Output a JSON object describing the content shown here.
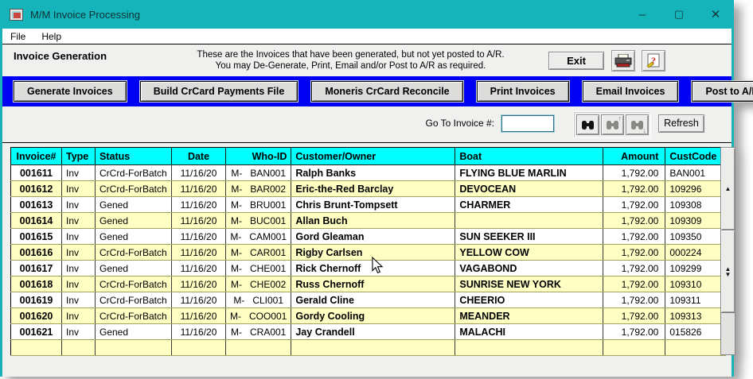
{
  "window": {
    "title": "M/M Invoice Processing",
    "controls": {
      "minimize": "–",
      "maximize": "▢",
      "close": "✕"
    }
  },
  "menu": {
    "file": "File",
    "help": "Help"
  },
  "header": {
    "section_title": "Invoice Generation",
    "description_line1": "These are the Invoices that have been generated, but not yet posted to A/R.",
    "description_line2": "You may De-Generate, Print, Email and/or  Post to A/R as required.",
    "exit_label": "Exit",
    "icons": {
      "print": "printer-icon",
      "help": "help-book-icon"
    }
  },
  "toolbar": {
    "buttons": [
      "Generate Invoices",
      "Build CrCard Payments File",
      "Moneris CrCard Reconcile",
      "Print Invoices",
      "Email Invoices",
      "Post to A/R"
    ]
  },
  "search": {
    "goto_label": "Go To Invoice #:",
    "goto_value": "",
    "refresh_label": "Refresh",
    "icons": {
      "find": "binoculars-icon",
      "find_prev": "binoculars-up-icon",
      "find_next": "binoculars-down-icon"
    }
  },
  "scroll": {
    "up_glyph": "▲",
    "updown_glyph_top": "▲",
    "updown_glyph_bottom": "▼"
  },
  "colors": {
    "titlebar": "#14b4ba",
    "toolbar_blue": "#0000f2",
    "grid_header": "#00ffff",
    "row_alt": "#ffffc4"
  },
  "grid": {
    "columns": [
      "Invoice#",
      "Type",
      "Status",
      "Date",
      "Who-ID",
      "Customer/Owner",
      "Boat",
      "Amount",
      "CustCode"
    ],
    "rows": [
      [
        "001611",
        "Inv",
        "CrCrd-ForBatch",
        "11/16/20",
        "M-   BAN001",
        "Ralph Banks",
        "FLYING BLUE MARLIN",
        "1,792.00",
        "BAN001"
      ],
      [
        "001612",
        "Inv",
        "CrCrd-ForBatch",
        "11/16/20",
        "M-   BAR002",
        "Eric-the-Red Barclay",
        "DEVOCEAN",
        "1,792.00",
        "109296"
      ],
      [
        "001613",
        "Inv",
        "Gened",
        "11/16/20",
        "M-   BRU001",
        "Chris Brunt-Tompsett",
        "CHARMER",
        "1,792.00",
        "109308"
      ],
      [
        "001614",
        "Inv",
        "Gened",
        "11/16/20",
        "M-   BUC001",
        "Allan Buch",
        "",
        "1,792.00",
        "109309"
      ],
      [
        "001615",
        "Inv",
        "Gened",
        "11/16/20",
        "M-   CAM001",
        "Gord Gleaman",
        "SUN SEEKER III",
        "1,792.00",
        "109350"
      ],
      [
        "001616",
        "Inv",
        "CrCrd-ForBatch",
        "11/16/20",
        "M-   CAR001",
        "Rigby Carlsen",
        "YELLOW COW",
        "1,792.00",
        "000224"
      ],
      [
        "001617",
        "Inv",
        "Gened",
        "11/16/20",
        "M-   CHE001",
        "Rick Chernoff",
        "VAGABOND",
        "1,792.00",
        "109299"
      ],
      [
        "001618",
        "Inv",
        "CrCrd-ForBatch",
        "11/16/20",
        "M-   CHE002",
        "Russ Chernoff",
        "SUNRISE NEW YORK",
        "1,792.00",
        "109310"
      ],
      [
        "001619",
        "Inv",
        "CrCrd-ForBatch",
        "11/16/20",
        "M-   CLI001",
        "Gerald Cline",
        "CHEERIO",
        "1,792.00",
        "109311"
      ],
      [
        "001620",
        "Inv",
        "CrCrd-ForBatch",
        "11/16/20",
        "M-   COO001",
        "Gordy Cooling",
        "MEANDER",
        "1,792.00",
        "109313"
      ],
      [
        "001621",
        "Inv",
        "Gened",
        "11/16/20",
        "M-   CRA001",
        "Jay Crandell",
        "MALACHI",
        "1,792.00",
        "015826"
      ],
      [
        "",
        "",
        "",
        "",
        "",
        "",
        "",
        "",
        ""
      ]
    ]
  }
}
